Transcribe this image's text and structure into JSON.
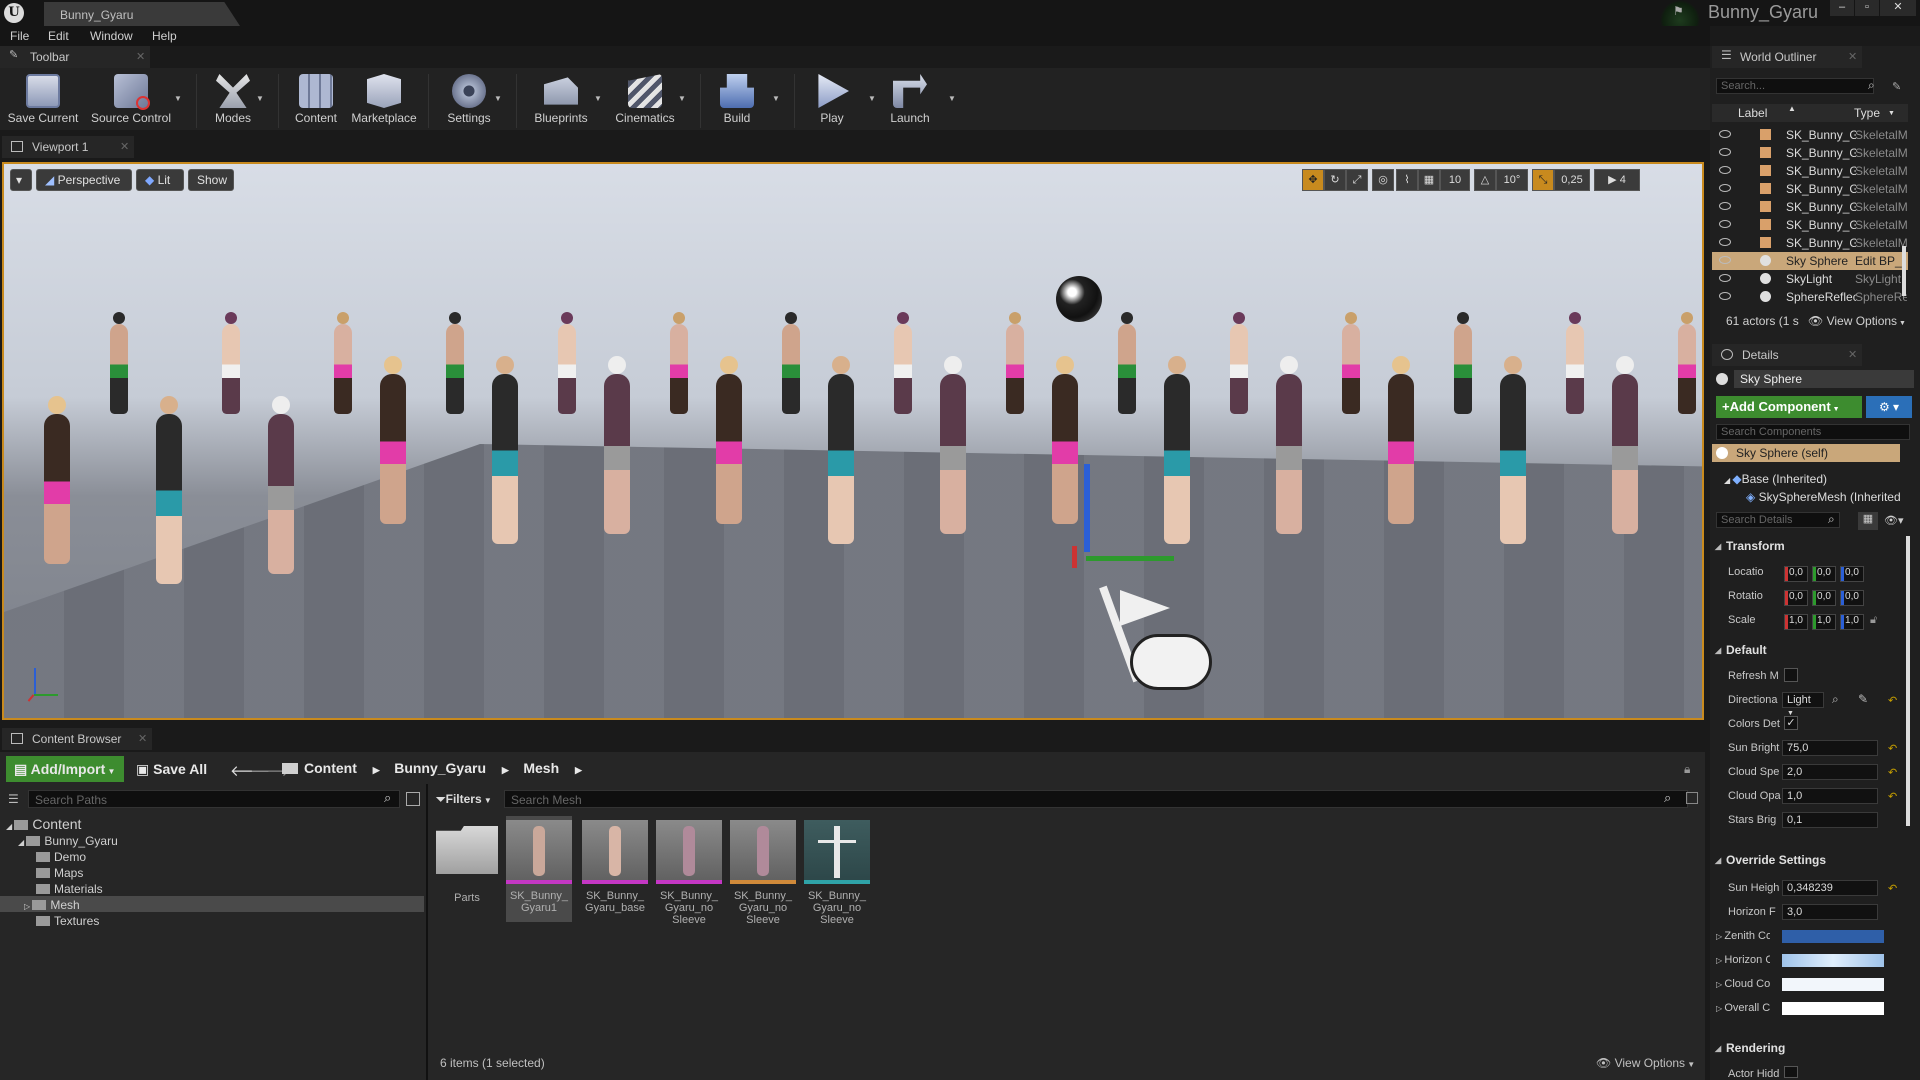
{
  "window": {
    "tab_title": "Bunny_Gyaru",
    "project_title": "Bunny_Gyaru",
    "logo": "U"
  },
  "menu": [
    "File",
    "Edit",
    "Window",
    "Help"
  ],
  "toolbar": {
    "tab": "Toolbar",
    "buttons": [
      {
        "label": "Save Current",
        "icon": "save-icon"
      },
      {
        "label": "Source Control",
        "icon": "source-control-icon"
      },
      {
        "label": "Modes",
        "icon": "modes-icon"
      },
      {
        "label": "Content",
        "icon": "content-icon"
      },
      {
        "label": "Marketplace",
        "icon": "marketplace-icon"
      },
      {
        "label": "Settings",
        "icon": "settings-icon"
      },
      {
        "label": "Blueprints",
        "icon": "blueprints-icon"
      },
      {
        "label": "Cinematics",
        "icon": "cinematics-icon"
      },
      {
        "label": "Build",
        "icon": "build-icon"
      },
      {
        "label": "Play",
        "icon": "play-icon"
      },
      {
        "label": "Launch",
        "icon": "launch-icon"
      }
    ]
  },
  "viewport": {
    "tab": "Viewport 1",
    "perspective": "Perspective",
    "lit": "Lit",
    "show": "Show",
    "grid_snap": "10",
    "rot_snap": "10°",
    "scale_snap": "0,25",
    "camera_speed": "4"
  },
  "content_browser": {
    "tab": "Content Browser",
    "add_import": "Add/Import",
    "save_all": "Save All",
    "breadcrumb": [
      "Content",
      "Bunny_Gyaru",
      "Mesh"
    ],
    "search_paths_placeholder": "Search Paths",
    "filters": "Filters",
    "search_mesh_placeholder": "Search Mesh",
    "tree": [
      {
        "label": "Content"
      },
      {
        "label": "Bunny_Gyaru"
      },
      {
        "label": "Demo"
      },
      {
        "label": "Maps"
      },
      {
        "label": "Materials"
      },
      {
        "label": "Mesh"
      },
      {
        "label": "Textures"
      }
    ],
    "assets": [
      {
        "line1": "Parts",
        "line2": "",
        "line3": ""
      },
      {
        "line1": "SK_Bunny_",
        "line2": "Gyaru1",
        "line3": ""
      },
      {
        "line1": "SK_Bunny_",
        "line2": "Gyaru_base",
        "line3": ""
      },
      {
        "line1": "SK_Bunny_",
        "line2": "Gyaru_no",
        "line3": "Sleeve"
      },
      {
        "line1": "SK_Bunny_",
        "line2": "Gyaru_no",
        "line3": "Sleeve"
      },
      {
        "line1": "SK_Bunny_",
        "line2": "Gyaru_no",
        "line3": "Sleeve"
      }
    ],
    "status": "6 items (1 selected)",
    "view_options": "View Options"
  },
  "outliner": {
    "tab": "World Outliner",
    "search_placeholder": "Search...",
    "col_label": "Label",
    "col_type": "Type",
    "rows": [
      {
        "name": "SK_Bunny_Gyaru",
        "type": "SkeletalM"
      },
      {
        "name": "SK_Bunny_Gyaru",
        "type": "SkeletalM"
      },
      {
        "name": "SK_Bunny_Gyaru",
        "type": "SkeletalM"
      },
      {
        "name": "SK_Bunny_Gyaru",
        "type": "SkeletalM"
      },
      {
        "name": "SK_Bunny_Gyaru",
        "type": "SkeletalM"
      },
      {
        "name": "SK_Bunny_Gyaru",
        "type": "SkeletalM"
      },
      {
        "name": "SK_Bunny_Gyaru",
        "type": "SkeletalM"
      },
      {
        "name": "Sky Sphere",
        "type": "Edit BP_"
      },
      {
        "name": "SkyLight",
        "type": "SkyLight"
      },
      {
        "name": "SphereReflection",
        "type": "SphereRe"
      }
    ],
    "actors": "61 actors (1 s",
    "view_options": "View Options"
  },
  "details": {
    "tab": "Details",
    "actor_name": "Sky Sphere",
    "add_component": "Add Component",
    "search_components_placeholder": "Search Components",
    "self_component": "Sky Sphere (self)",
    "base": "Base (Inherited)",
    "sky_mesh": "SkySphereMesh (Inherited",
    "search_details_placeholder": "Search Details",
    "transform": "Transform",
    "location": "Locatio",
    "rotation": "Rotatio",
    "scale": "Scale",
    "loc_values": [
      "0,0",
      "0,0",
      "0,0"
    ],
    "rot_values": [
      "0,0",
      "0,0",
      "0,0"
    ],
    "scale_values": [
      "1,0",
      "1,0",
      "1,0"
    ],
    "default": "Default",
    "refresh": "Refresh M",
    "directional": "Directiona",
    "directional_value": "Light",
    "colors_det": "Colors Det",
    "sun_brightness": "Sun Bright",
    "sun_brightness_value": "75,0",
    "cloud_speed": "Cloud Spe",
    "cloud_speed_value": "2,0",
    "cloud_opacity": "Cloud Opa",
    "cloud_opacity_value": "1,0",
    "stars_brightness": "Stars Brig",
    "stars_brightness_value": "0,1",
    "override": "Override Settings",
    "sun_height": "Sun Heigh",
    "sun_height_value": "0,348239",
    "horizon_falloff": "Horizon F",
    "horizon_falloff_value": "3,0",
    "zenith_color": "Zenith Co",
    "horizon_color": "Horizon C",
    "cloud_color": "Cloud Col",
    "overall_color": "Overall Co",
    "rendering": "Rendering",
    "actor_hidden": "Actor Hidd"
  },
  "colors": {
    "accent_green": "#3d8c2f",
    "selection_orange": "#c88a1e",
    "details_blue": "#2b6fb8",
    "zenith": "#2f5fa8",
    "horizon": "#a9c7e6"
  }
}
